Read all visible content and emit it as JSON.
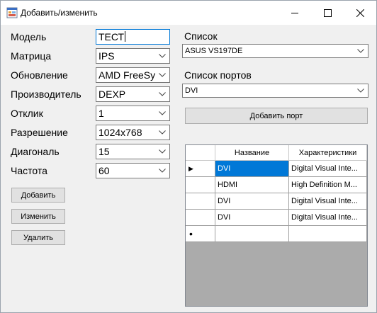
{
  "window": {
    "title": "Добавить/изменить",
    "icon": "app-form-icon",
    "controls": [
      "minimize-icon",
      "maximize-icon",
      "close-icon"
    ]
  },
  "form": {
    "model": {
      "label": "Модель",
      "value": "ТЕСТ"
    },
    "matrix": {
      "label": "Матрица",
      "value": "IPS"
    },
    "refresh": {
      "label": "Обновление",
      "value": "AMD FreeSy"
    },
    "manufacturer": {
      "label": "Производитель",
      "value": "DEXP"
    },
    "response": {
      "label": "Отклик",
      "value": "1"
    },
    "resolution": {
      "label": "Разрешение",
      "value": "1024x768"
    },
    "diagonal": {
      "label": "Диагональ",
      "value": "15"
    },
    "frequency": {
      "label": "Частота",
      "value": "60"
    }
  },
  "buttons": {
    "add": "Добавить",
    "edit": "Изменить",
    "delete": "Удалить",
    "add_port": "Добавить порт"
  },
  "list": {
    "label": "Список",
    "value": "ASUS VS197DE"
  },
  "ports_list": {
    "label": "Список портов",
    "value": "DVI"
  },
  "grid": {
    "columns": [
      "Название",
      "Характеристики"
    ],
    "rows": [
      {
        "name": "DVI",
        "desc": "Digital Visual Inte...",
        "selected": true
      },
      {
        "name": "HDMI",
        "desc": "High Definition M...",
        "selected": false
      },
      {
        "name": "DVI",
        "desc": "Digital Visual Inte...",
        "selected": false
      },
      {
        "name": "DVI",
        "desc": "Digital Visual Inte...",
        "selected": false
      }
    ],
    "current_row_marker": "▶",
    "new_row_marker": "•"
  },
  "colors": {
    "selection": "#0078d7",
    "grid_bg": "#ababab",
    "focus_border": "#0078d7"
  }
}
